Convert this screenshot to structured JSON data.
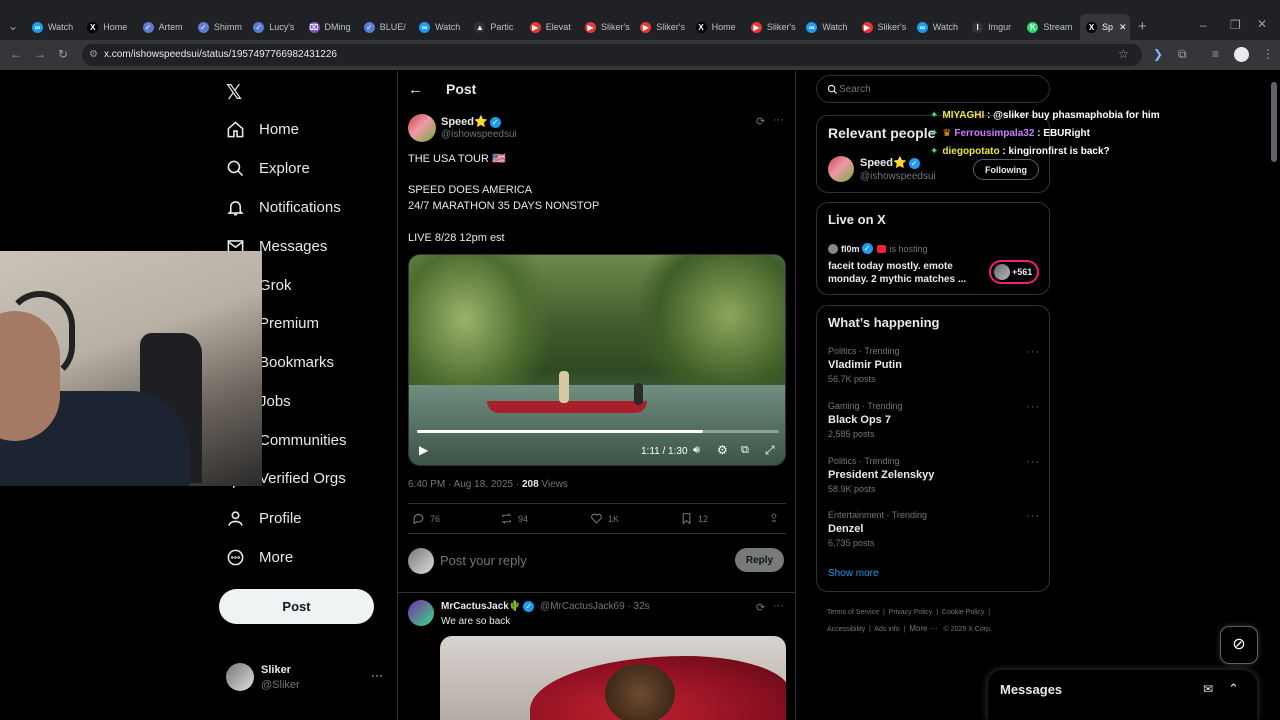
{
  "tabs": [
    "Watch",
    "Home",
    "Artem",
    "Shimm",
    "Lucy's",
    "DMing",
    "BLUE/",
    "Watch",
    "Partic",
    "Elevat",
    "Sliker's",
    "Sliker's",
    "Home",
    "Sliker's",
    "Watch",
    "Sliker's",
    "Watch",
    "Imgur",
    "Stream",
    "Sp"
  ],
  "url": "x.com/ishowspeedsui/status/1957497766982431226",
  "nav": {
    "home": "Home",
    "explore": "Explore",
    "notifications": "Notifications",
    "messages": "Messages",
    "grok": "Grok",
    "premium": "Premium",
    "bookmarks": "Bookmarks",
    "jobs": "Jobs",
    "communities": "Communities",
    "verified_orgs": "Verified Orgs",
    "profile": "Profile",
    "more": "More",
    "post_button": "Post"
  },
  "account": {
    "name": "Sliker",
    "handle": "@Sliker"
  },
  "header": {
    "title": "Post"
  },
  "post": {
    "name": "Speed⭐",
    "handle": "@ishowspeedsui",
    "line1": "THE USA TOUR 🇺🇸",
    "line2": "SPEED DOES AMERICA",
    "line3": "24/7 MARATHON 35 DAYS NONSTOP",
    "line4": "LIVE 8/28 12pm est",
    "video_time": "1:11 / 1:30",
    "video_progress": 0.79,
    "timestamp": "6:40 PM · Aug 18, 2025 · ",
    "views_count": "208",
    "views_label": " Views",
    "replies": "76",
    "reposts": "94",
    "likes": "1K",
    "bookmarks": "12"
  },
  "reply_box": {
    "placeholder": "Post your reply",
    "button": "Reply"
  },
  "reply": {
    "name": "MrCactusJack🌵",
    "handle": "@MrCactusJack69 · 32s",
    "text": "We are so back"
  },
  "search": {
    "placeholder": "Search"
  },
  "relevant": {
    "title": "Relevant people",
    "name": "Speed⭐",
    "handle": "@ishowspeedsui",
    "follow_label": "Following"
  },
  "live": {
    "title": "Live on X",
    "host": "fl0m",
    "hosting": "is hosting",
    "description1": "faceit today mostly. emote",
    "description2": "monday. 2 mythic matches ...",
    "count": "+561"
  },
  "happening": {
    "title": "What’s happening",
    "trends": [
      {
        "category": "Politics · Trending",
        "name": "Vladimir Putin",
        "count": "56.7K posts"
      },
      {
        "category": "Gaming · Trending",
        "name": "Black Ops 7",
        "count": "2,585 posts"
      },
      {
        "category": "Politics · Trending",
        "name": "President Zelenskyy",
        "count": "58.9K posts"
      },
      {
        "category": "Entertainment · Trending",
        "name": "Denzel",
        "count": "6,735 posts"
      }
    ],
    "show_more": "Show more"
  },
  "footer": {
    "terms": "Terms of Service",
    "privacy": "Privacy Policy",
    "cookie": "Cookie Policy",
    "accessibility": "Accessibility",
    "ads": "Ads info",
    "more": "More ···",
    "copyright": "© 2025 X Corp."
  },
  "chat": [
    {
      "user": "MIYAGHI",
      "color": "#f0e442",
      "text": " : @sliker buy phasmaphobia for him"
    },
    {
      "user": "Ferrousimpala32",
      "color": "#c77dff",
      "text": " : EBURight"
    },
    {
      "user": "diegopotato",
      "color": "#f0e442",
      "text": " : kingironfirst is back?"
    }
  ],
  "messages_dock": {
    "title": "Messages"
  },
  "colors": {
    "accent": "#1d9bf0",
    "background": "#000000",
    "border": "#2f3336",
    "muted": "#71767b"
  }
}
